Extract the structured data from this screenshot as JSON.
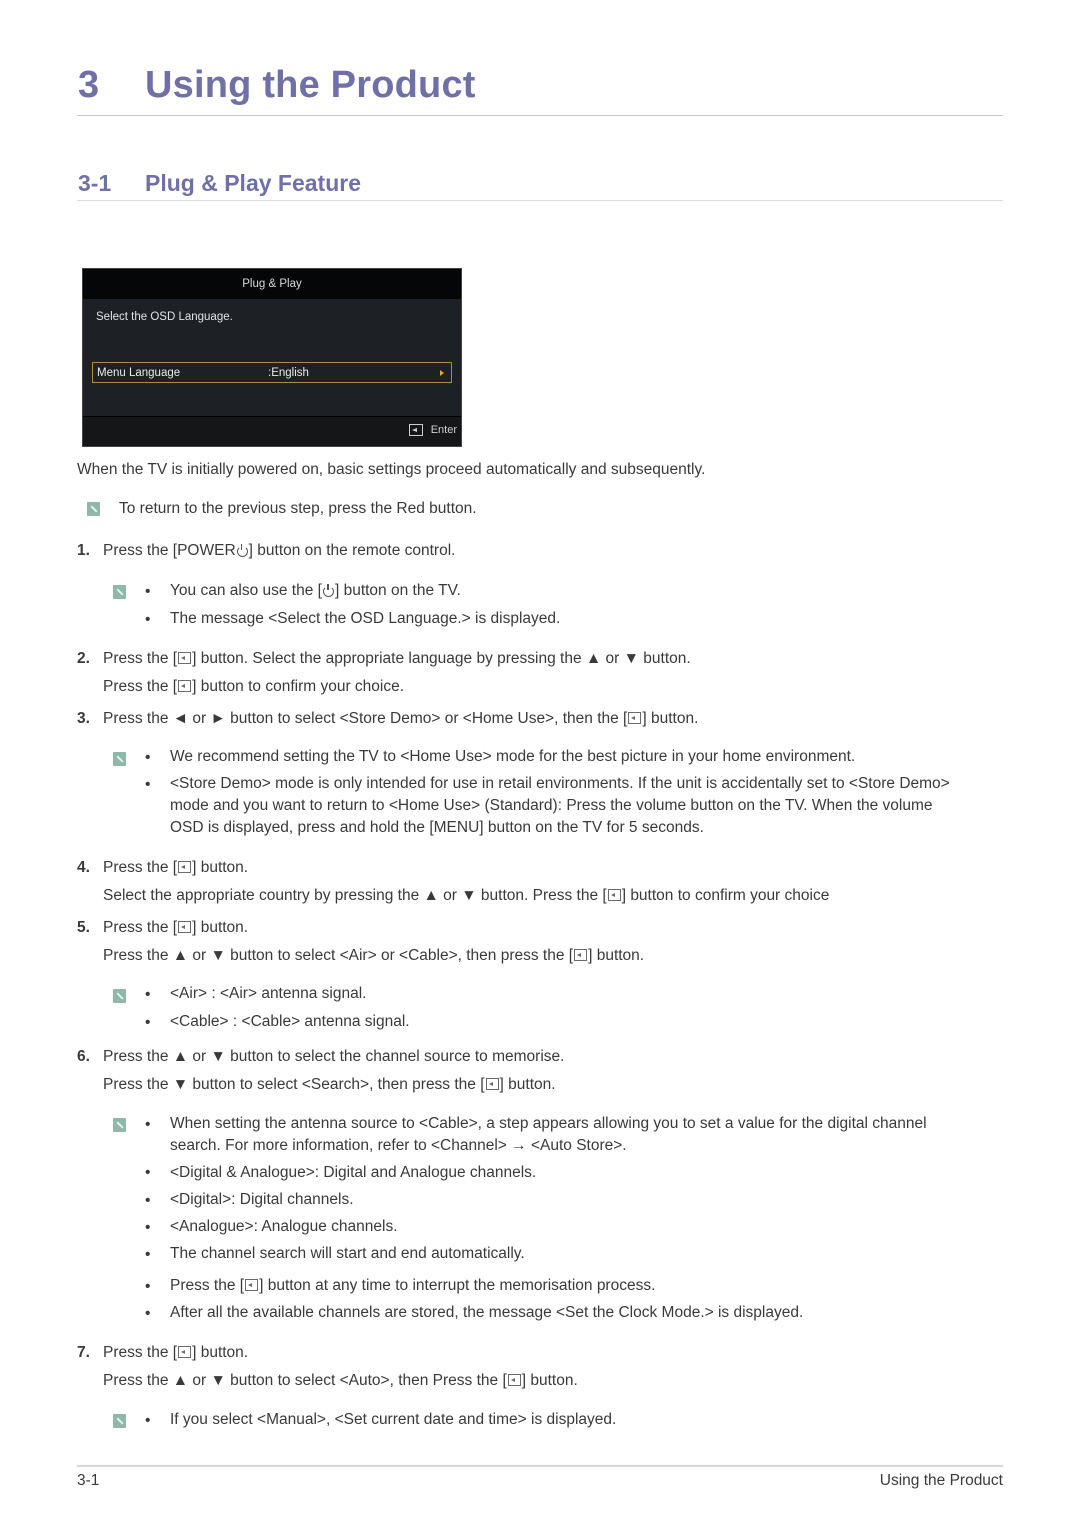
{
  "chapter": {
    "number": "3",
    "title": "Using the Product"
  },
  "section": {
    "number": "3-1",
    "title": "Plug & Play Feature"
  },
  "osd": {
    "title": "Plug & Play",
    "prompt": "Select the OSD Language.",
    "row_label": "Menu Language",
    "row_value": ":English",
    "footer_label": "Enter",
    "colors": {
      "highlight_border": "#b08a3a",
      "arrow": "#e8a62a"
    }
  },
  "intro": "When the TV is initially powered on, basic settings proceed automatically and subsequently.",
  "intro_note": "To return to the previous step, press the Red button.",
  "steps": {
    "s1": {
      "num": "1.",
      "a": "Press the [POWER",
      "b": "] button on the remote control."
    },
    "s1_notes": {
      "n1a": "You can also use the [",
      "n1b": "] button on the TV.",
      "n2": "The message <Select the OSD Language.> is displayed."
    },
    "s2": {
      "num": "2.",
      "l1a": "Press the [",
      "l1b": "] button. Select the appropriate language by pressing the ▲ or ▼ button.",
      "l2a": "Press the [",
      "l2b": "] button to confirm your choice."
    },
    "s3": {
      "num": "3.",
      "a": "Press the ◄ or ► button to select <Store Demo> or <Home Use>, then the [",
      "b": "] button."
    },
    "s3_notes": {
      "n1": "We recommend setting the TV to <Home Use> mode for the best picture in your home environment.",
      "n2_l1": "<Store Demo> mode is only intended for use in retail environments. If the unit is accidentally set to <Store Demo>",
      "n2_l2": "mode and you want to return to <Home Use> (Standard): Press the volume button on the TV. When the volume",
      "n2_l3": "OSD is displayed, press and hold the [MENU] button on the TV for 5 seconds."
    },
    "s4": {
      "num": "4.",
      "l1a": "Press the [",
      "l1b": "] button.",
      "l2a": "Select the appropriate country by pressing the ▲ or ▼ button. Press the [",
      "l2b": "] button to confirm your choice"
    },
    "s5": {
      "num": "5.",
      "l1a": "Press the [",
      "l1b": "] button.",
      "l2a": "Press the ▲ or ▼ button to select <Air> or <Cable>, then press the [",
      "l2b": "] button."
    },
    "s5_notes": {
      "n1": "<Air> : <Air> antenna signal.",
      "n2": "<Cable> : <Cable> antenna signal."
    },
    "s6": {
      "num": "6.",
      "l1": "Press the ▲ or ▼ button to select the channel source to memorise.",
      "l2a": "Press the ▼ button to select <Search>, then press the [",
      "l2b": "] button."
    },
    "s6_notes": {
      "n1_l1": "When setting the antenna source to <Cable>, a step appears allowing you to set a value for the digital channel",
      "n1_l2": "search. For more information, refer to <Channel> → <Auto Store>.",
      "n2": "<Digital & Analogue>: Digital and Analogue channels.",
      "n3": "<Digital>: Digital channels.",
      "n4": "<Analogue>: Analogue channels.",
      "n5": "The channel search will start and end automatically.",
      "n6a": "Press the [",
      "n6b": "] button at any time to interrupt the memorisation process.",
      "n7": "After all the available channels are stored, the message <Set the Clock Mode.> is displayed."
    },
    "s7": {
      "num": "7.",
      "l1a": "Press the [",
      "l1b": "] button.",
      "l2a": "Press the ▲ or ▼ button to select <Auto>, then Press the [",
      "l2b": "] button."
    },
    "s7_notes": {
      "n1": "If you select <Manual>, <Set current date and time> is displayed."
    }
  },
  "bullet_char": "•",
  "footer": {
    "page": "3-1",
    "title": "Using the Product"
  }
}
